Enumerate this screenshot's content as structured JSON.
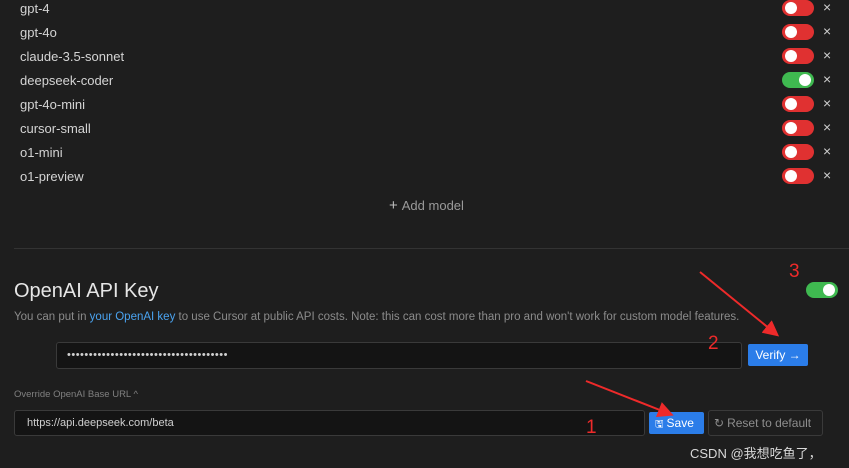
{
  "models": [
    {
      "name": "gpt-4",
      "enabled": false
    },
    {
      "name": "gpt-4o",
      "enabled": false
    },
    {
      "name": "claude-3.5-sonnet",
      "enabled": false
    },
    {
      "name": "deepseek-coder",
      "enabled": true
    },
    {
      "name": "gpt-4o-mini",
      "enabled": false
    },
    {
      "name": "cursor-small",
      "enabled": false
    },
    {
      "name": "o1-mini",
      "enabled": false
    },
    {
      "name": "o1-preview",
      "enabled": false
    }
  ],
  "remove_glyph": "×",
  "add_model": {
    "plus": "+",
    "label": "Add model"
  },
  "openai_section": {
    "title": "OpenAI API Key",
    "enabled": true,
    "description_pre": "You can put in ",
    "description_link": "your OpenAI key",
    "description_post": " to use Cursor at public API costs. Note: this can cost more than pro and won't work for custom model features.",
    "api_key_value": "•••••••••••••••••••••••••••••••••••••",
    "verify_label": "Verify →",
    "override_label": "Override OpenAI Base URL ^",
    "base_url_value": "https://api.deepseek.com/beta",
    "save_icon": "🖫",
    "save_label": "Save",
    "reset_icon": "↻",
    "reset_label": "Reset to default"
  },
  "annotations": {
    "one": "1",
    "two": "2",
    "three": "3"
  },
  "annotation_color": "#ee2a2a",
  "colors": {
    "toggle_on": "#3fb950",
    "toggle_off": "#e03131",
    "accent": "#2b7de9"
  },
  "watermark": "CSDN @我想吃鱼了，"
}
